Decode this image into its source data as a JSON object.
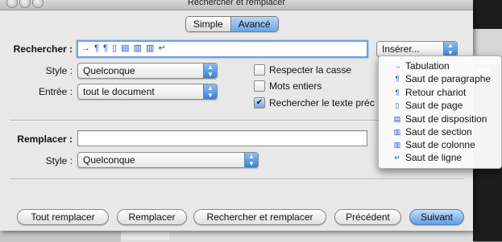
{
  "window": {
    "title": "Rechercher et remplacer"
  },
  "mode_tabs": {
    "simple": "Simple",
    "advanced": "Avancé",
    "selected": "Avancé"
  },
  "search": {
    "label": "Rechercher :",
    "value": "→ ¶ ¶ ▯ ▤ ▥ ▥ ↵",
    "insert_button": "Insérer...",
    "style_label": "Style :",
    "style_value": "Quelconque",
    "scope_label": "Entrée :",
    "scope_value": "tout le document",
    "options": [
      {
        "label": "Respecter la casse",
        "checked": false
      },
      {
        "label": "Mots entiers",
        "checked": false
      },
      {
        "label": "Rechercher le texte préc",
        "checked": true
      }
    ]
  },
  "replace": {
    "label": "Remplacer :",
    "value": "",
    "style_label": "Style :",
    "style_value": "Quelconque"
  },
  "buttons": {
    "replace_all": "Tout remplacer",
    "replace": "Remplacer",
    "find_replace": "Rechercher et remplacer",
    "previous": "Précédent",
    "next": "Suivant"
  },
  "insert_menu": {
    "items": [
      {
        "icon": "tab-arrow-icon",
        "glyph": "→",
        "label": "Tabulation"
      },
      {
        "icon": "paragraph-icon",
        "glyph": "¶",
        "label": "Saut de paragraphe"
      },
      {
        "icon": "paragraph-icon",
        "glyph": "¶",
        "label": "Retour chariot"
      },
      {
        "icon": "page-icon",
        "glyph": "▯",
        "label": "Saut de page"
      },
      {
        "icon": "layout-icon",
        "glyph": "▤",
        "label": "Saut de disposition"
      },
      {
        "icon": "section-icon",
        "glyph": "▥",
        "label": "Saut de section"
      },
      {
        "icon": "column-icon",
        "glyph": "▥",
        "label": "Saut de colonne"
      },
      {
        "icon": "line-break-icon",
        "glyph": "↵",
        "label": "Saut de ligne"
      }
    ]
  },
  "colors": {
    "accent": "#6aa5e6",
    "focus_ring": "#6da0e0"
  }
}
